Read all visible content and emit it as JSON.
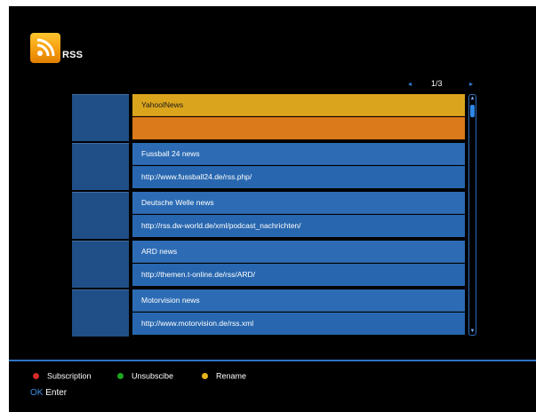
{
  "app": {
    "title": "RSS",
    "icon": "rss-icon",
    "icon_color": "#f7a21b"
  },
  "pagination": {
    "page": "1/3"
  },
  "feeds": [
    {
      "name": "YahoolNews",
      "url": "",
      "selected": true
    },
    {
      "name": "Fussball 24 news",
      "url": "http://www.fussball24.de/rss.php/",
      "selected": false
    },
    {
      "name": "Deutsche Welle news",
      "url": "http://rss.dw-world.de/xml/podcast_nachrichten/",
      "selected": false
    },
    {
      "name": "ARD news",
      "url": "http://themen.t-online.de/rss/ARD/",
      "selected": false
    },
    {
      "name": "Motorvision news",
      "url": "http://www.motorvision.de/rss.xml",
      "selected": false
    }
  ],
  "footer": {
    "hints": [
      {
        "color": "#d42a2a",
        "label": "Subscription"
      },
      {
        "color": "#1ea31e",
        "label": "Unsubscibe"
      },
      {
        "color": "#e2b31c",
        "label": "Rename"
      }
    ],
    "ok_key": "OK",
    "ok_label": "Enter"
  },
  "colors": {
    "background": "#000000",
    "row_blue": "#2d6cb4",
    "selected_top": "#dba41d",
    "selected_bottom": "#db7a1b",
    "accent": "#2f73c5"
  }
}
